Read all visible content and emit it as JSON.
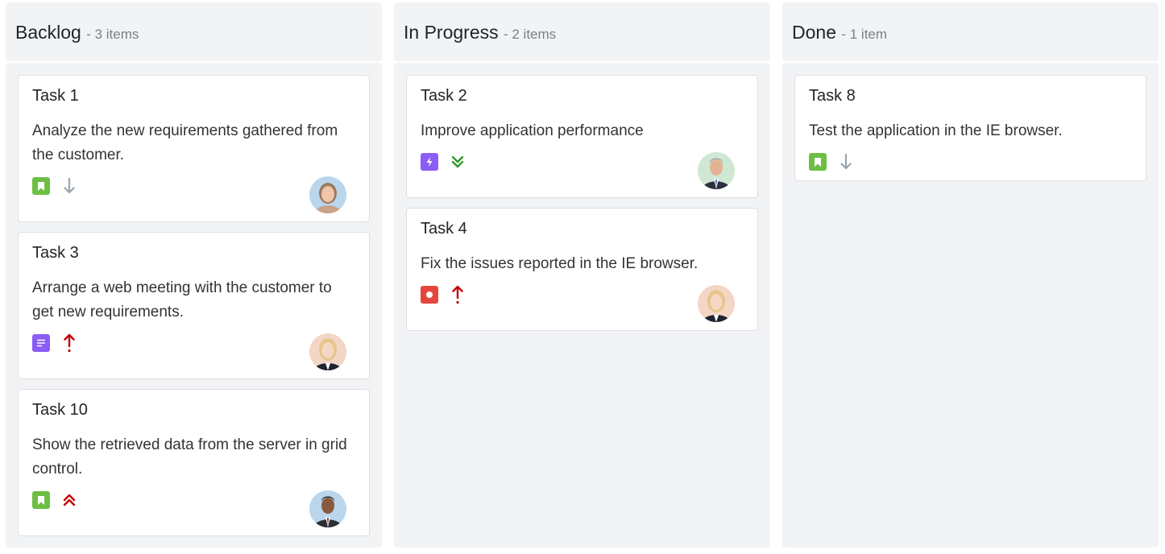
{
  "columns": [
    {
      "title": "Backlog",
      "count_label": "- 3 items",
      "cards": [
        {
          "title": "Task 1",
          "desc": "Analyze the new requirements gathered from the customer.",
          "type": "story-icon",
          "priority": "low-priority-arrow-icon",
          "avatar": "woman-avatar"
        },
        {
          "title": "Task 3",
          "desc": "Arrange a web meeting with the customer to get new requirements.",
          "type": "task-icon",
          "priority": "high-priority-arrow-icon",
          "avatar": "blonde-woman-avatar"
        },
        {
          "title": "Task 10",
          "desc": "Show the retrieved data from the server in grid control.",
          "type": "story-icon",
          "priority": "critical-priority-chevrons-icon",
          "avatar": "man-avatar"
        }
      ]
    },
    {
      "title": "In Progress",
      "count_label": "- 2 items",
      "cards": [
        {
          "title": "Task 2",
          "desc": "Improve application performance",
          "type": "improvement-icon",
          "priority": "lowest-priority-chevrons-icon",
          "avatar": "older-man-avatar"
        },
        {
          "title": "Task 4",
          "desc": "Fix the issues reported in the IE browser.",
          "type": "bug-icon",
          "priority": "high-priority-arrow-icon",
          "avatar": "blonde-woman-avatar"
        }
      ]
    },
    {
      "title": "Done",
      "count_label": "- 1 item",
      "cards": [
        {
          "title": "Task 8",
          "desc": "Test the application in the IE browser.",
          "type": "story-icon",
          "priority": "low-priority-arrow-icon",
          "avatar": ""
        }
      ]
    }
  ],
  "colors": {
    "column_bg": "#f2f3f5",
    "story": "#6cbf43",
    "task": "#8b5cf6",
    "bug": "#e5453a",
    "low_arrow": "#9aa3ad",
    "high_arrow": "#c40000",
    "lowest_chevron": "#2e9a2e"
  }
}
